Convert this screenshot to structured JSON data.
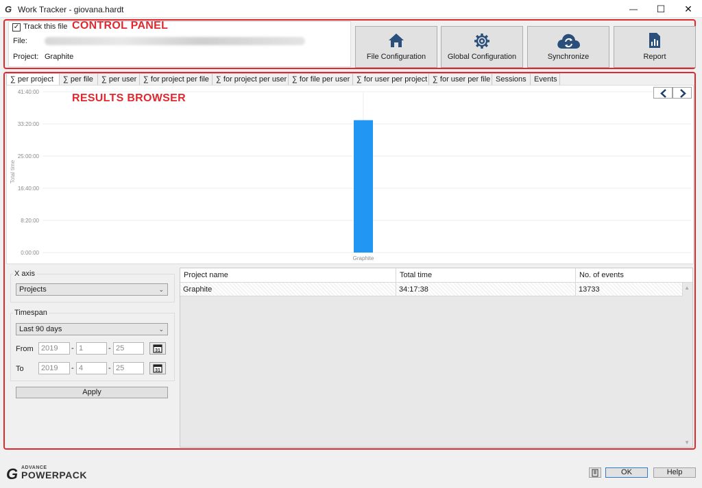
{
  "window": {
    "app_icon": "G",
    "title": "Work Tracker - giovana.hardt",
    "minimize_glyph": "—",
    "maximize_glyph": "☐",
    "close_glyph": "✕"
  },
  "annotations": {
    "control_panel": "CONTROL PANEL",
    "results_browser": "RESULTS BROWSER",
    "color": "#e0282e"
  },
  "control_panel": {
    "track_checked": true,
    "track_label": "Track this file",
    "file_label": "File:",
    "project_label": "Project:",
    "project_value": "Graphite",
    "buttons": [
      {
        "label": "File Configuration",
        "icon": "home-icon"
      },
      {
        "label": "Global Configuration",
        "icon": "gear-icon"
      },
      {
        "label": "Synchronize",
        "icon": "cloud-sync-icon"
      },
      {
        "label": "Report",
        "icon": "report-icon"
      }
    ],
    "icon_color": "#2a4f7a"
  },
  "tabs": [
    {
      "label": "∑ per project",
      "active": true
    },
    {
      "label": "∑ per file",
      "active": false
    },
    {
      "label": "∑ per user",
      "active": false
    },
    {
      "label": "∑ for project per file",
      "active": false
    },
    {
      "label": "∑ for project per user",
      "active": false
    },
    {
      "label": "∑ for file per user",
      "active": false
    },
    {
      "label": "∑ for user per project",
      "active": false
    },
    {
      "label": "∑ for user per file",
      "active": false
    },
    {
      "label": "Sessions",
      "active": false
    },
    {
      "label": "Events",
      "active": false
    }
  ],
  "chart_nav": {
    "prev_icon": "chevron-left-icon",
    "next_icon": "chevron-right-icon"
  },
  "chart_data": {
    "type": "bar",
    "categories": [
      "Graphite"
    ],
    "values": [
      123458
    ],
    "ylabel": "Total time",
    "ylim": [
      0,
      150000
    ],
    "yticks": [
      0,
      30000,
      60000,
      90000,
      120000,
      150000
    ],
    "ytick_labels": [
      "0:00:00",
      "8:20:00",
      "16:40:00",
      "25:00:00",
      "33:20:00",
      "41:40:00"
    ],
    "grid": true,
    "bar_color": "#2196f3"
  },
  "filters": {
    "x_axis_label": "X axis",
    "x_axis_value": "Projects",
    "timespan_label": "Timespan",
    "timespan_value": "Last 90 days",
    "from_label": "From",
    "from": {
      "year": "2019",
      "month": "1",
      "day": "25"
    },
    "to_label": "To",
    "to": {
      "year": "2019",
      "month": "4",
      "day": "25"
    },
    "date_sep": "-",
    "calendar_day": "31",
    "apply_label": "Apply"
  },
  "table": {
    "columns": [
      "Project name",
      "Total time",
      "No. of events"
    ],
    "rows": [
      [
        "Graphite",
        "34:17:38",
        "13733"
      ]
    ]
  },
  "footer": {
    "logo_letter": "G",
    "logo_small": "ADVANCE",
    "logo_big": "POWERPACK",
    "ok_label": "OK",
    "help_label": "Help",
    "book_icon": "book-icon"
  }
}
